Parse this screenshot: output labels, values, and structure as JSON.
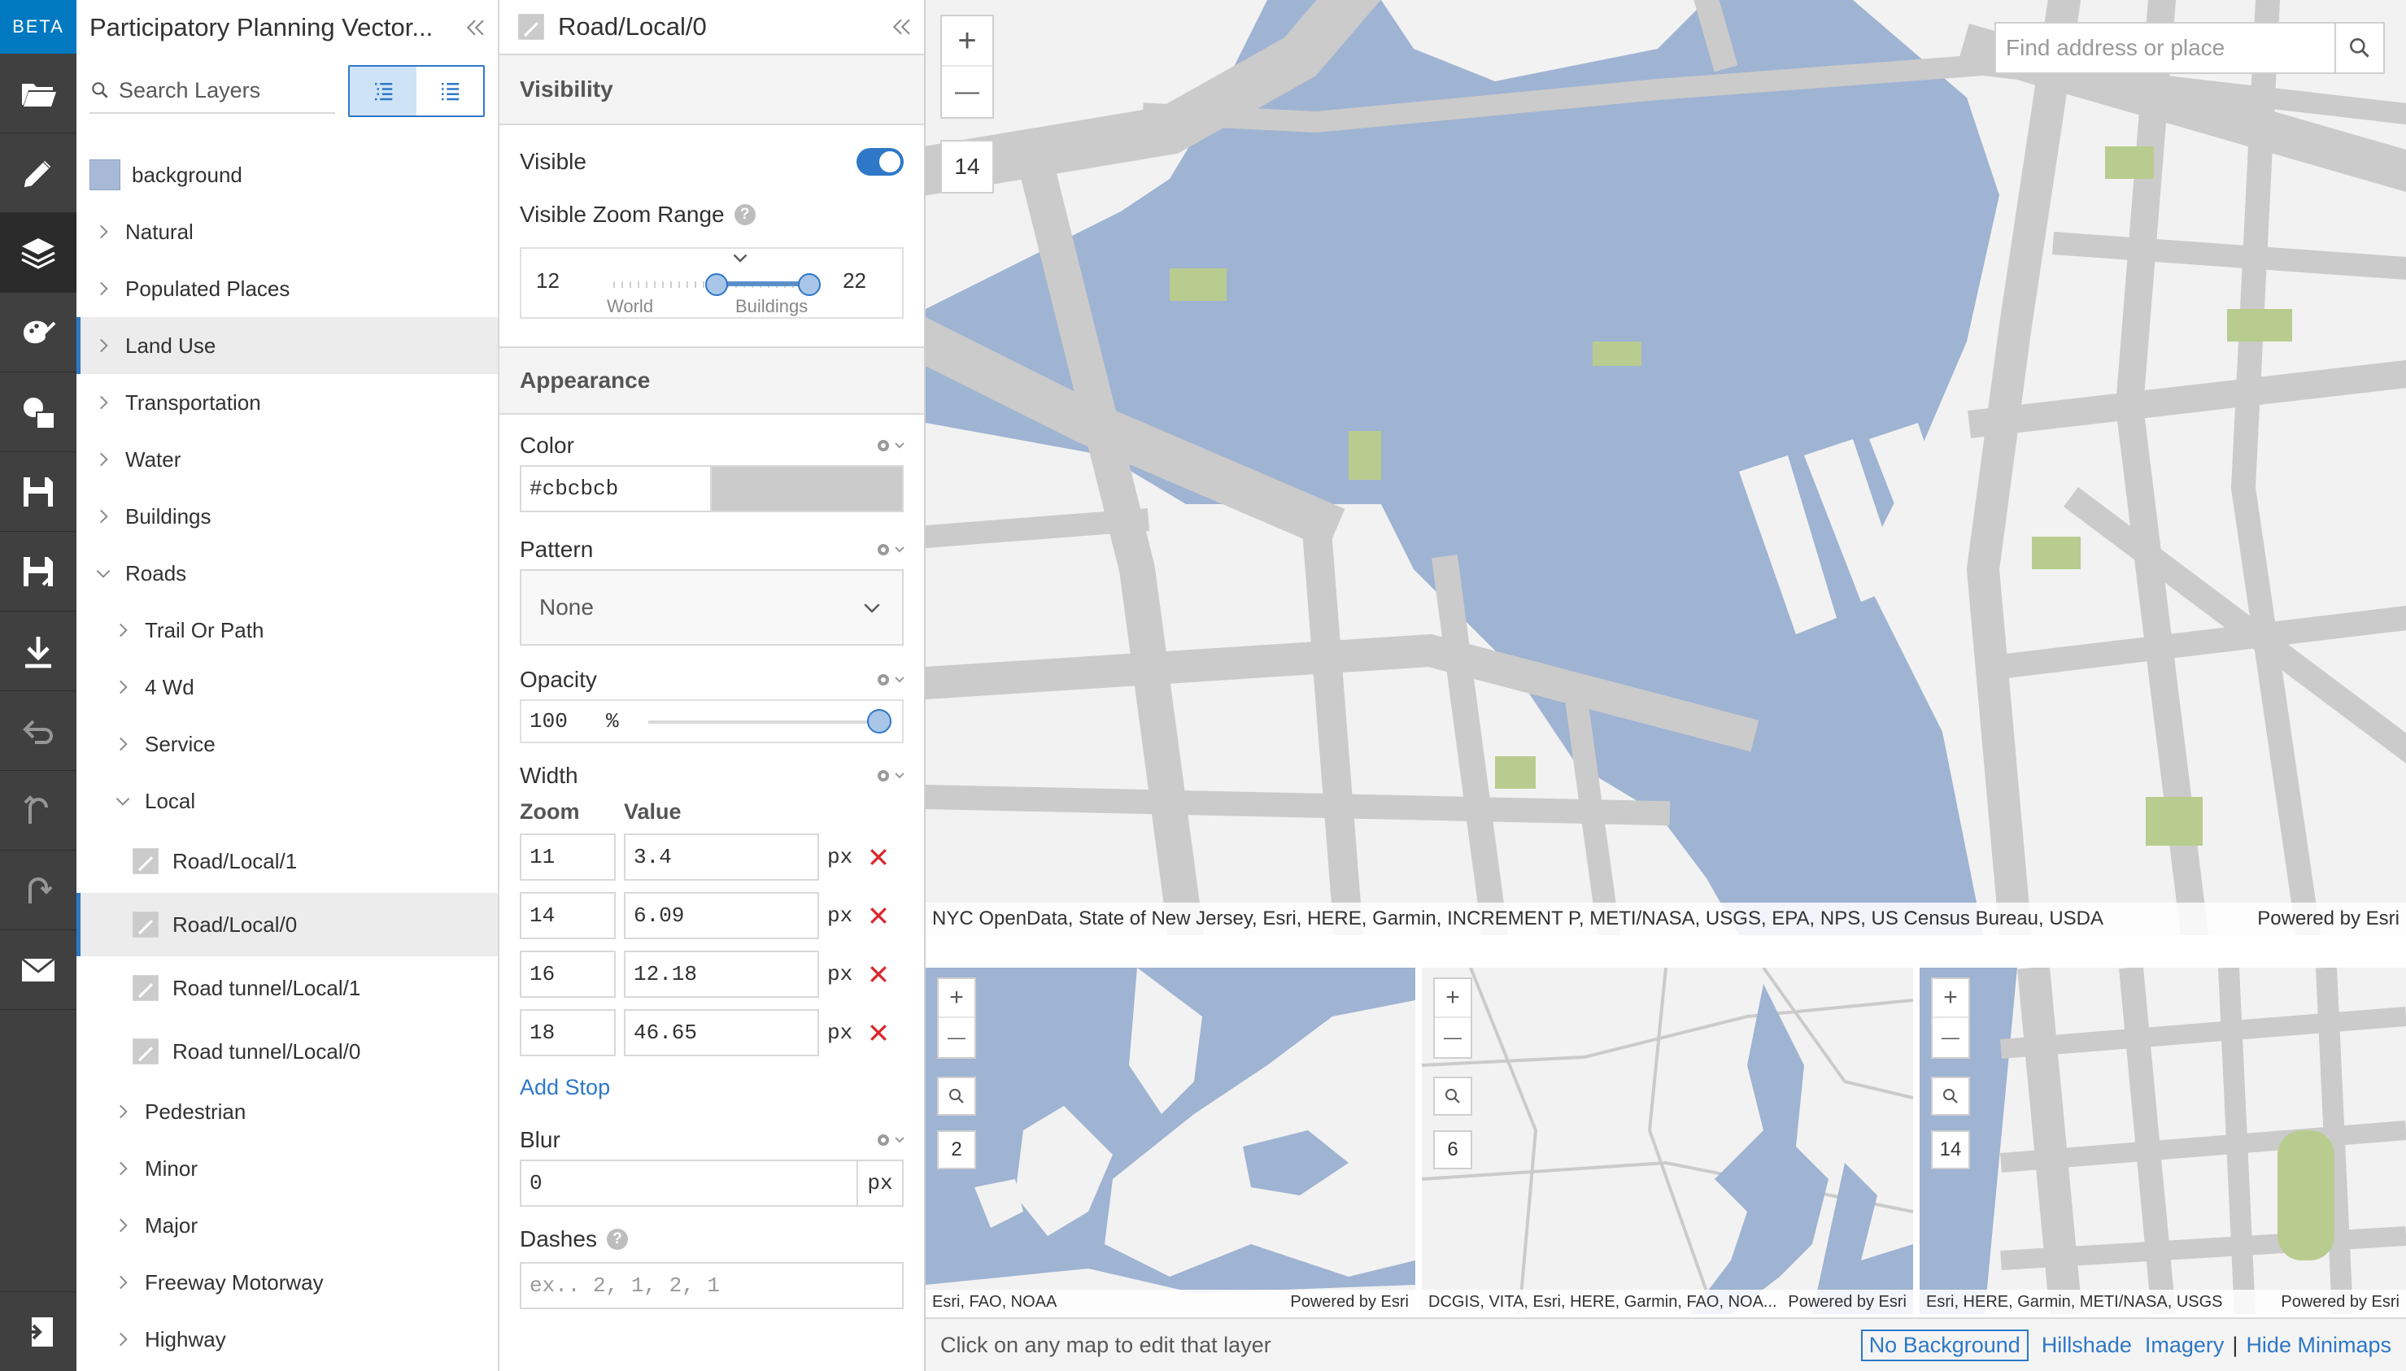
{
  "rail": {
    "beta": "BETA",
    "items": [
      {
        "icon": "folder-open-icon"
      },
      {
        "icon": "pencil-icon"
      },
      {
        "icon": "layers-icon",
        "active": true
      },
      {
        "icon": "palette-icon"
      },
      {
        "icon": "shapes-icon"
      },
      {
        "icon": "save-icon"
      },
      {
        "icon": "save-as-icon"
      },
      {
        "icon": "download-icon"
      },
      {
        "icon": "undo-icon",
        "disabled": true
      },
      {
        "icon": "undo-arrow-icon",
        "disabled": true
      },
      {
        "icon": "redo-icon",
        "disabled": true
      },
      {
        "icon": "mail-icon"
      }
    ],
    "bottom_icon": "exit-icon"
  },
  "layers_panel": {
    "title": "Participatory Planning Vector...",
    "search_placeholder": "Search Layers",
    "tree": [
      {
        "label": "background",
        "type": "swatch",
        "swatch_color": "#a7b9d6"
      },
      {
        "label": "Natural",
        "type": "group"
      },
      {
        "label": "Populated Places",
        "type": "group"
      },
      {
        "label": "Land Use",
        "type": "group",
        "selected": true
      },
      {
        "label": "Transportation",
        "type": "group"
      },
      {
        "label": "Water",
        "type": "group"
      },
      {
        "label": "Buildings",
        "type": "group"
      },
      {
        "label": "Roads",
        "type": "group",
        "expanded": true
      },
      {
        "label": "Trail Or Path",
        "type": "subgroup"
      },
      {
        "label": "4 Wd",
        "type": "subgroup"
      },
      {
        "label": "Service",
        "type": "subgroup"
      },
      {
        "label": "Local",
        "type": "subgroup",
        "expanded": true
      },
      {
        "label": "Road/Local/1",
        "type": "leaf"
      },
      {
        "label": "Road/Local/0",
        "type": "leaf",
        "selected": true
      },
      {
        "label": "Road tunnel/Local/1",
        "type": "leaf"
      },
      {
        "label": "Road tunnel/Local/0",
        "type": "leaf"
      },
      {
        "label": "Pedestrian",
        "type": "subgroup"
      },
      {
        "label": "Minor",
        "type": "subgroup"
      },
      {
        "label": "Major",
        "type": "subgroup"
      },
      {
        "label": "Freeway Motorway",
        "type": "subgroup"
      },
      {
        "label": "Highway",
        "type": "subgroup"
      }
    ]
  },
  "style_panel": {
    "title": "Road/Local/0",
    "visibility": {
      "section": "Visibility",
      "visible_label": "Visible",
      "visible": true,
      "zoom_range_label": "Visible Zoom Range",
      "help": "?",
      "min_zoom": "12",
      "max_zoom": "22",
      "world_label": "World",
      "buildings_label": "Buildings"
    },
    "appearance": {
      "section": "Appearance",
      "color_label": "Color",
      "color_value": "#cbcbcb",
      "pattern_label": "Pattern",
      "pattern_value": "None",
      "opacity_label": "Opacity",
      "opacity_value": "100",
      "opacity_unit": "%",
      "opacity_fraction": 1.0,
      "width_label": "Width",
      "zoom_header": "Zoom",
      "value_header": "Value",
      "stops": [
        {
          "zoom": "11",
          "value": "3.4",
          "unit": "px"
        },
        {
          "zoom": "14",
          "value": "6.09",
          "unit": "px"
        },
        {
          "zoom": "16",
          "value": "12.18",
          "unit": "px"
        },
        {
          "zoom": "18",
          "value": "46.65",
          "unit": "px"
        }
      ],
      "add_stop": "Add Stop",
      "blur_label": "Blur",
      "blur_value": "0",
      "blur_unit": "px",
      "dashes_label": "Dashes",
      "dashes_placeholder": "ex.. 2, 1, 2, 1"
    }
  },
  "map": {
    "zoom_in": "+",
    "zoom_out": "—",
    "zoom_level": "14",
    "search_placeholder": "Find address or place",
    "attribution": "NYC OpenData, State of New Jersey, Esri, HERE, Garmin, INCREMENT P, METI/NASA, USGS, EPA, NPS, US Census Bureau, USDA",
    "powered_by": "Powered by Esri",
    "colors": {
      "water": "#9fb3d2",
      "land": "#f2f2f2",
      "road": "#cbcbcb",
      "park": "#b9cc8f"
    }
  },
  "minimaps": [
    {
      "zoom": "2",
      "attribution": "Esri, FAO, NOAA",
      "powered_by": "Powered by Esri"
    },
    {
      "zoom": "6",
      "attribution": "DCGIS, VITA, Esri, HERE, Garmin, FAO, NOA...",
      "powered_by": "Powered by Esri"
    },
    {
      "zoom": "14",
      "attribution": "Esri, HERE, Garmin, METI/NASA, USGS",
      "powered_by": "Powered by Esri"
    }
  ],
  "footer": {
    "hint": "Click on any map to edit that layer",
    "options": [
      "No Background",
      "Hillshade",
      "Imagery"
    ],
    "separator": "|",
    "hide_minimaps": "Hide Minimaps"
  }
}
